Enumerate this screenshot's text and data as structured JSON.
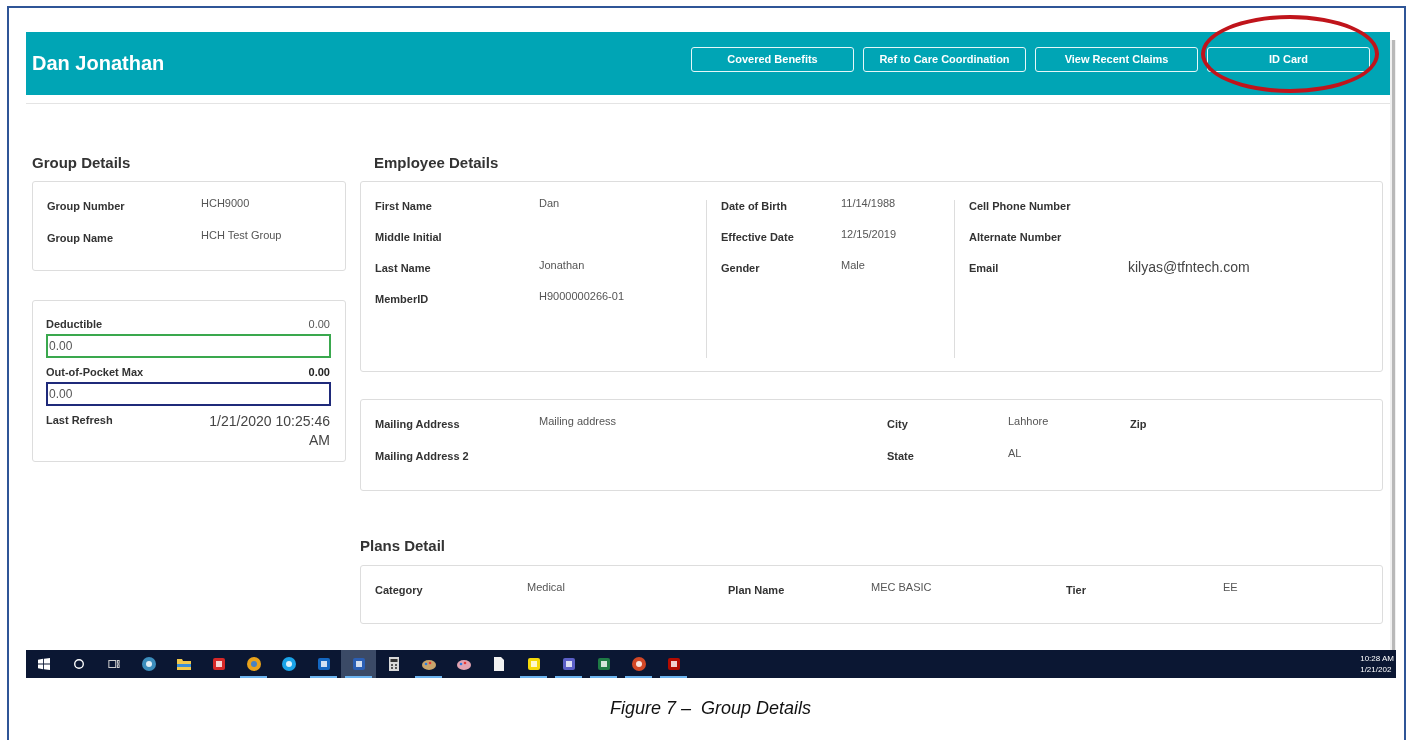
{
  "header": {
    "title": "Dan Jonathan",
    "buttons": [
      {
        "label": "Covered Benefits",
        "circled": false
      },
      {
        "label": "Ref to Care Coordination",
        "circled": false
      },
      {
        "label": "View Recent Claims",
        "circled": false
      },
      {
        "label": "ID Card",
        "circled": true
      }
    ]
  },
  "group_details": {
    "title": "Group Details",
    "fields": [
      {
        "label": "Group Number",
        "value": "HCH9000"
      },
      {
        "label": "Group Name",
        "value": "HCH Test Group"
      }
    ]
  },
  "accumulators": {
    "items": [
      {
        "label": "Deductible",
        "value": "0.00",
        "emphasized": false,
        "input_value": "0.00",
        "color": "#3aa84e"
      },
      {
        "label": "Out-of-Pocket Max",
        "value": "0.00",
        "emphasized": true,
        "input_value": "0.00",
        "color": "#1f2a7a"
      }
    ],
    "last_refresh": {
      "label": "Last Refresh",
      "value": "1/21/2020 10:25:46 AM"
    }
  },
  "employee_details": {
    "title": "Employee Details",
    "columns": [
      [
        {
          "label": "First Name",
          "value": "Dan"
        },
        {
          "label": "Middle Initial"
        },
        {
          "label": "Last Name",
          "value": "Jonathan"
        },
        {
          "label": "MemberID",
          "value": "H9000000266-01"
        }
      ],
      [
        {
          "label": "Date of Birth",
          "value": "11/14/1988"
        },
        {
          "label": "Effective Date",
          "value": "12/15/2019"
        },
        {
          "label": "Gender",
          "value": "Male"
        }
      ],
      [
        {
          "label": "Cell Phone Number"
        },
        {
          "label": "Alternate Number"
        },
        {
          "label": "Email",
          "value": "kilyas@tfntech.com",
          "large": true
        }
      ]
    ]
  },
  "address": {
    "columns": [
      [
        {
          "label": "Mailing Address",
          "value": "Mailing address"
        },
        {
          "label": "Mailing Address 2"
        }
      ],
      [
        {
          "label": "City",
          "value": "Lahhore"
        },
        {
          "label": "State",
          "value": "AL"
        }
      ],
      [
        {
          "label": "Zip"
        }
      ]
    ]
  },
  "plans_detail": {
    "title": "Plans Detail",
    "fields": [
      {
        "label": "Category",
        "value": "Medical"
      },
      {
        "label": "Plan Name",
        "value": "MEC BASIC"
      },
      {
        "label": "Tier",
        "value": "EE"
      }
    ]
  },
  "taskbar": {
    "apps": [
      {
        "kind": "globe",
        "running": false,
        "selected": false
      },
      {
        "kind": "folder",
        "running": false,
        "selected": false
      },
      {
        "kind": "red-app",
        "running": false,
        "selected": false
      },
      {
        "kind": "chrome",
        "running": true,
        "selected": false
      },
      {
        "kind": "skype",
        "running": false,
        "selected": false
      },
      {
        "kind": "outlook",
        "running": true,
        "selected": false
      },
      {
        "kind": "word",
        "running": true,
        "selected": true
      },
      {
        "kind": "calculator",
        "running": false,
        "selected": false
      },
      {
        "kind": "paint",
        "running": true,
        "selected": false
      },
      {
        "kind": "paint3d",
        "running": false,
        "selected": false
      },
      {
        "kind": "file",
        "running": false,
        "selected": false
      },
      {
        "kind": "sticky",
        "running": true,
        "selected": false
      },
      {
        "kind": "teams",
        "running": true,
        "selected": false
      },
      {
        "kind": "excel",
        "running": true,
        "selected": false
      },
      {
        "kind": "powerpoint",
        "running": true,
        "selected": false
      },
      {
        "kind": "pdf",
        "running": true,
        "selected": false
      }
    ],
    "clock": {
      "time": "10:28 AM",
      "date": "1/21/202"
    }
  },
  "caption": "Figure 7 –  Group Details"
}
